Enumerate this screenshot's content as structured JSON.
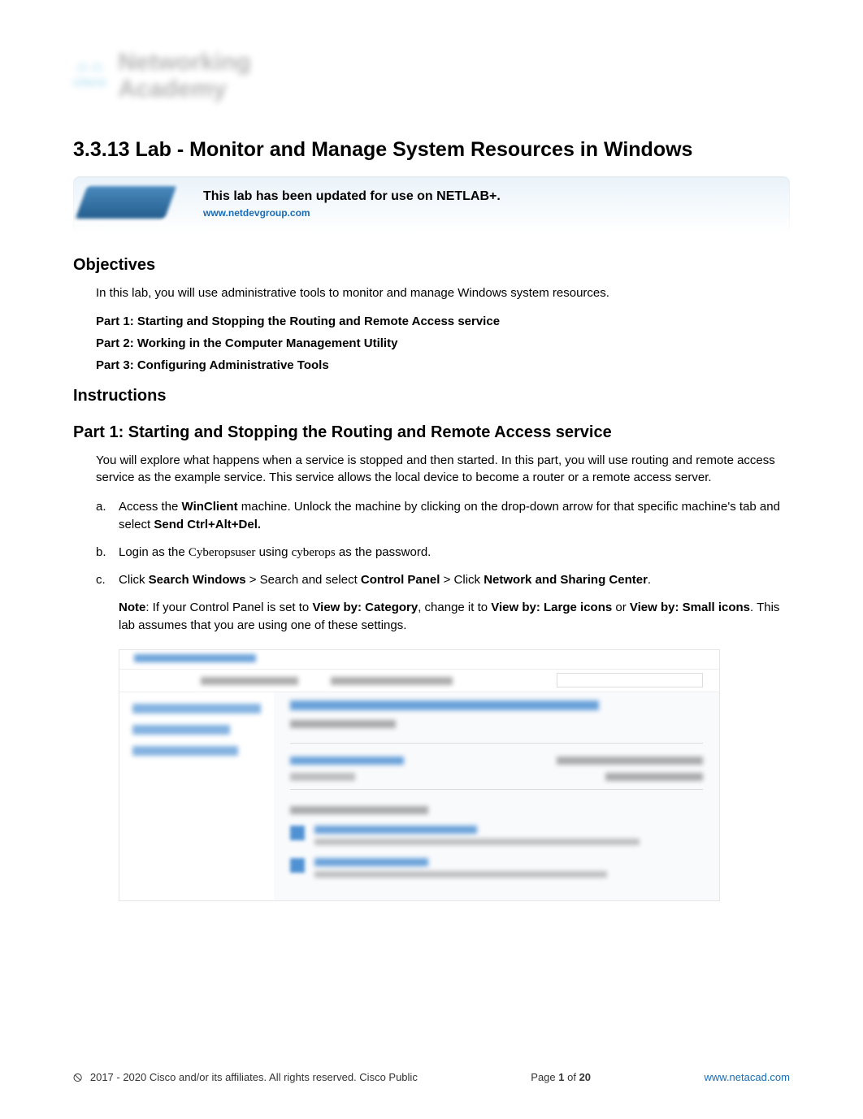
{
  "logo": {
    "brand_line1": "Networking",
    "brand_line2": "Academy",
    "mark_name": "cisco"
  },
  "title": "3.3.13 Lab - Monitor and Manage System Resources in Windows",
  "netlab": {
    "heading": "This lab has been updated for use on NETLAB+.",
    "link": "www.netdevgroup.com"
  },
  "sections": {
    "objectives_heading": "Objectives",
    "objectives_intro": "In this lab, you will use administrative tools to monitor and manage Windows system resources.",
    "parts": [
      "Part 1: Starting and Stopping the Routing and Remote Access service",
      "Part 2: Working in the Computer Management Utility",
      "Part 3: Configuring Administrative Tools"
    ],
    "instructions_heading": "Instructions",
    "part1_heading": "Part 1: Starting and Stopping the Routing and Remote Access service",
    "part1_intro": "You will explore what happens when a service is stopped and then started. In this part, you will use routing and remote access service as the example service. This service allows the local device to become a router or a remote access server.",
    "steps": {
      "a": {
        "letter": "a.",
        "pre": "Access the ",
        "bold1": "WinClient",
        "mid": " machine. Unlock the machine by clicking on the drop-down arrow for that specific machine's tab and select ",
        "bold2": "Send Ctrl+Alt+Del."
      },
      "b": {
        "letter": "b.",
        "pre": "Login as the ",
        "user": "Cyberopsuser",
        "mid": " using ",
        "pass": "cyberops",
        "post": " as the password."
      },
      "c": {
        "letter": "c.",
        "pre": "Click ",
        "bold1": "Search Windows",
        "arrow1": " > ",
        "mid1": "Search and select ",
        "bold2": "Control Panel",
        "arrow2": " > ",
        "mid2": "Click ",
        "bold3": "Network and Sharing Center",
        "post": "."
      }
    },
    "note": {
      "label": "Note",
      "pre": ": If your Control Panel is set to ",
      "bold1": "View by: Category",
      "mid1": ", change it to ",
      "bold2": "View by: Large icons",
      "mid2": " or ",
      "bold3": "View by: Small icons",
      "post": ". This lab assumes that you are using one of these settings."
    }
  },
  "footer": {
    "copyright": "2017 - 2020 Cisco and/or its affiliates. All rights reserved. Cisco Public",
    "page_label": "Page ",
    "page_current": "1",
    "page_of": " of ",
    "page_total": "20",
    "url": "www.netacad.com"
  }
}
